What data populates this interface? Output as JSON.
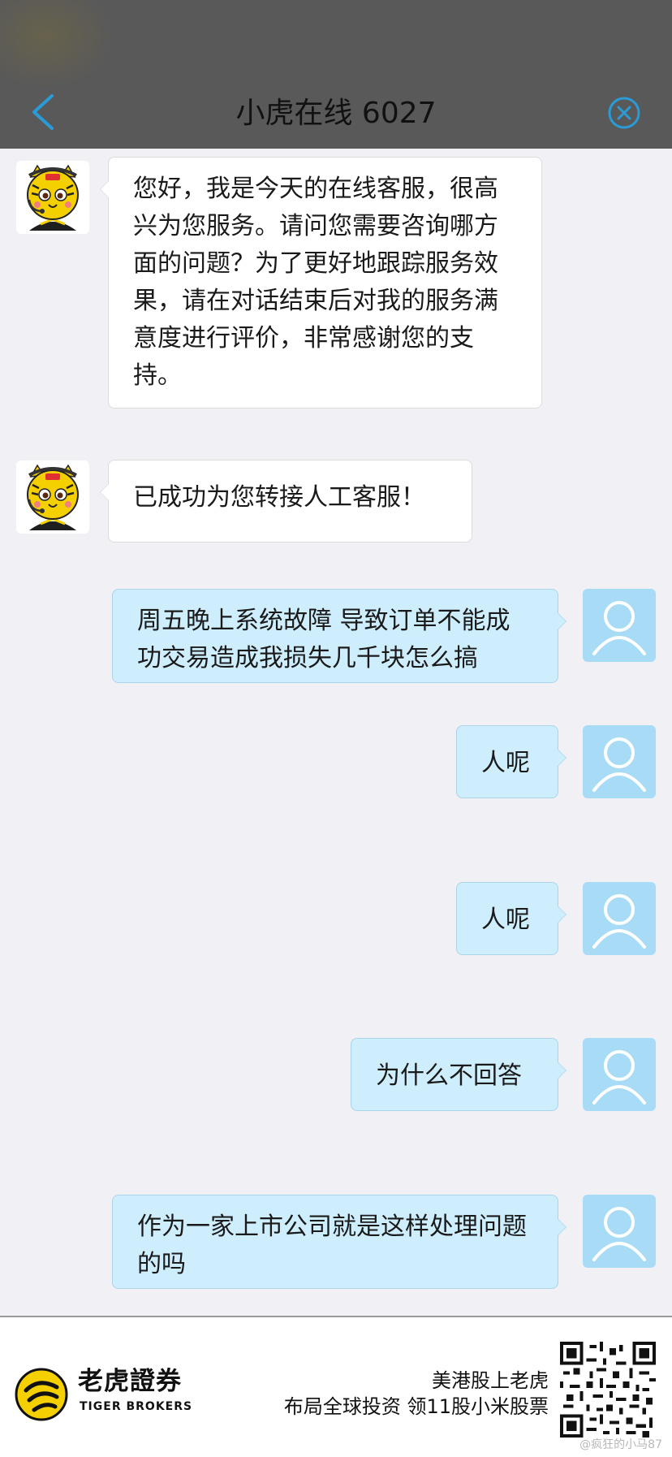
{
  "header": {
    "title": "小虎在线 6027",
    "back_icon": "chevron-left-icon",
    "close_icon": "circle-x-icon",
    "accent_color": "#2a9bd6"
  },
  "messages": [
    {
      "sender": "agent",
      "text": "您好，我是今天的在线客服，很高兴为您服务。请问您需要咨询哪方面的问题？为了更好地跟踪服务效果，请在对话结束后对我的服务满意度进行评价，非常感谢您的支持。"
    },
    {
      "sender": "agent",
      "text": "已成功为您转接人工客服！"
    },
    {
      "sender": "user",
      "text": "周五晚上系统故障 导致订单不能成功交易造成我损失几千块怎么搞"
    },
    {
      "sender": "user",
      "text": "人呢"
    },
    {
      "sender": "user",
      "text": "人呢"
    },
    {
      "sender": "user",
      "text": "为什么不回答"
    },
    {
      "sender": "user",
      "text": "作为一家上市公司就是这样处理问题的吗"
    }
  ],
  "ad": {
    "brand_cn": "老虎證券",
    "brand_en": "TIGER BROKERS",
    "line1": "美港股上老虎",
    "line2": "布局全球投资 领11股小米股票",
    "watermark": "@疯狂的小马87"
  }
}
